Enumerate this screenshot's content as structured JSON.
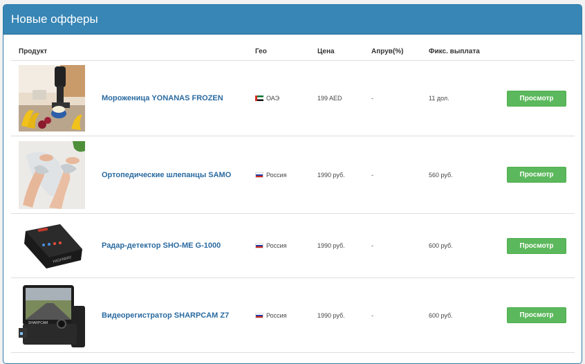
{
  "panel": {
    "title": "Новые офферы"
  },
  "table": {
    "headers": {
      "product": "Продукт",
      "geo": "Гео",
      "price": "Цена",
      "approve": "Апрув(%)",
      "fixed_payout": "Фикс. выплата"
    },
    "rows": [
      {
        "name": "Мороженица YONANAS FROZEN",
        "geo": "ОАЭ",
        "flag": "uae-flag",
        "price": "199 AED",
        "approve": "-",
        "payout": "11 дол.",
        "button": "Просмотр"
      },
      {
        "name": "Ортопедические шлепанцы SAMO",
        "geo": "Россия",
        "flag": "russia-flag",
        "price": "1990 руб.",
        "approve": "-",
        "payout": "560 руб.",
        "button": "Просмотр"
      },
      {
        "name": "Радар-детектор SHO-ME G-1000",
        "geo": "Россия",
        "flag": "russia-flag",
        "price": "1990 руб.",
        "approve": "-",
        "payout": "600 руб.",
        "button": "Просмотр"
      },
      {
        "name": "Видеорегистратор SHARPCAM Z7",
        "geo": "Россия",
        "flag": "russia-flag",
        "price": "1990 руб.",
        "approve": "-",
        "payout": "600 руб.",
        "button": "Просмотр"
      }
    ]
  },
  "colors": {
    "header_bg": "#3786b5",
    "button_bg": "#5cb85c",
    "link": "#2a6aa0"
  }
}
